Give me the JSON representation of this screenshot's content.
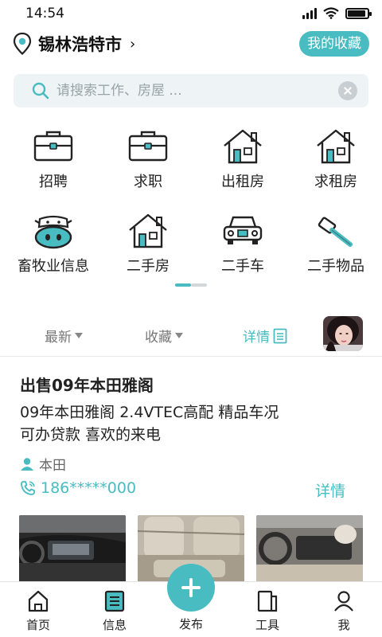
{
  "status_bar": {
    "time": "14:54",
    "battery_level": 0.85
  },
  "header": {
    "city": "锡林浩特市",
    "city_chevron": "›",
    "favorites_button": "我的收藏"
  },
  "search": {
    "placeholder": "请搜索工作、房屋 ..."
  },
  "categories": [
    {
      "label": "招聘",
      "icon": "briefcase-icon"
    },
    {
      "label": "求职",
      "icon": "briefcase-icon"
    },
    {
      "label": "出租房",
      "icon": "house-icon"
    },
    {
      "label": "求租房",
      "icon": "house-icon"
    },
    {
      "label": "畜牧业信息",
      "icon": "cow-icon"
    },
    {
      "label": "二手房",
      "icon": "house-icon"
    },
    {
      "label": "二手车",
      "icon": "car-icon"
    },
    {
      "label": "二手物品",
      "icon": "hammer-icon"
    }
  ],
  "filters": {
    "latest": "最新",
    "favorites": "收藏",
    "detail": "详情"
  },
  "post": {
    "title": "出售09年本田雅阁",
    "desc_line1": "09年本田雅阁 2.4VTEC高配 精品车况",
    "desc_line2": "可办贷款 喜欢的来电",
    "user": "本田",
    "phone": "186*****000",
    "detail_link": "详情"
  },
  "tabbar": {
    "home": "首页",
    "messages": "信息",
    "publish": "发布",
    "tools": "工具",
    "me": "我"
  },
  "colors": {
    "accent": "#48bcc1",
    "text": "#222222",
    "muted": "#777777"
  }
}
